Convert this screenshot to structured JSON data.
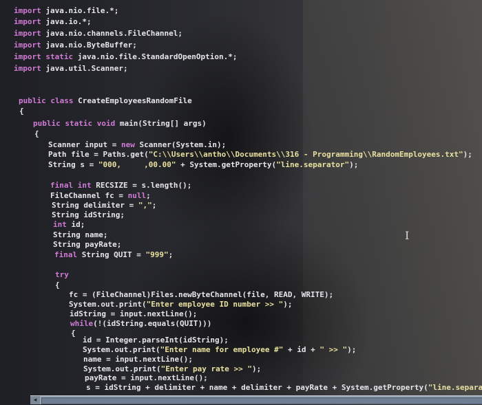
{
  "editor": {
    "lines": [
      [
        {
          "t": "import",
          "c": "kw"
        },
        {
          "t": " java.nio.file.*;",
          "c": "plain"
        }
      ],
      [
        {
          "t": "import",
          "c": "kw"
        },
        {
          "t": " java.io.*;",
          "c": "plain"
        }
      ],
      [
        {
          "t": "import",
          "c": "kw"
        },
        {
          "t": " java.nio.channels.FileChannel;",
          "c": "plain"
        }
      ],
      [
        {
          "t": "import",
          "c": "kw"
        },
        {
          "t": " java.nio.ByteBuffer;",
          "c": "plain"
        }
      ],
      [
        {
          "t": "import",
          "c": "kw"
        },
        {
          "t": " ",
          "c": "plain"
        },
        {
          "t": "static",
          "c": "kw"
        },
        {
          "t": " java.nio.file.StandardOpenOption.*;",
          "c": "plain"
        }
      ],
      [
        {
          "t": "import",
          "c": "kw"
        },
        {
          "t": " java.util.Scanner;",
          "c": "plain"
        }
      ],
      [
        {
          "t": "public",
          "c": "kw"
        },
        {
          "t": " ",
          "c": "plain"
        },
        {
          "t": "class",
          "c": "kw"
        },
        {
          "t": " CreateEmployeesRandomFile",
          "c": "plain"
        }
      ],
      [
        {
          "t": "{",
          "c": "plain"
        }
      ],
      [
        {
          "t": "public",
          "c": "kw"
        },
        {
          "t": " ",
          "c": "plain"
        },
        {
          "t": "static",
          "c": "kw"
        },
        {
          "t": " ",
          "c": "plain"
        },
        {
          "t": "void",
          "c": "kw"
        },
        {
          "t": " main(String[] args)",
          "c": "plain"
        }
      ],
      [
        {
          "t": "{",
          "c": "plain"
        }
      ],
      [
        {
          "t": "Scanner input = ",
          "c": "plain"
        },
        {
          "t": "new",
          "c": "kw"
        },
        {
          "t": " Scanner(System.in);",
          "c": "plain"
        }
      ],
      [
        {
          "t": "Path file = Paths.get(",
          "c": "plain"
        },
        {
          "t": "\"C:\\\\Users\\\\antho\\\\Documents\\\\316 - Programming\\\\RandomEmployees.txt\"",
          "c": "str"
        },
        {
          "t": ");",
          "c": "plain"
        }
      ],
      [
        {
          "t": "String s = ",
          "c": "plain"
        },
        {
          "t": "\"000,     ,00.00\"",
          "c": "str"
        },
        {
          "t": " + System.getProperty(",
          "c": "plain"
        },
        {
          "t": "\"line.separator\"",
          "c": "str"
        },
        {
          "t": ");",
          "c": "plain"
        }
      ],
      [
        {
          "t": "final",
          "c": "kw"
        },
        {
          "t": " ",
          "c": "plain"
        },
        {
          "t": "int",
          "c": "kw"
        },
        {
          "t": " RECSIZE = s.length();",
          "c": "plain"
        }
      ],
      [
        {
          "t": "FileChannel fc = ",
          "c": "plain"
        },
        {
          "t": "null",
          "c": "kw"
        },
        {
          "t": ";",
          "c": "plain"
        }
      ],
      [
        {
          "t": "String delimiter = ",
          "c": "plain"
        },
        {
          "t": "\",\"",
          "c": "str"
        },
        {
          "t": ";",
          "c": "plain"
        }
      ],
      [
        {
          "t": "String idString;",
          "c": "plain"
        }
      ],
      [
        {
          "t": "int",
          "c": "kw"
        },
        {
          "t": " id;",
          "c": "plain"
        }
      ],
      [
        {
          "t": "String name;",
          "c": "plain"
        }
      ],
      [
        {
          "t": "String payRate;",
          "c": "plain"
        }
      ],
      [
        {
          "t": "final",
          "c": "kw"
        },
        {
          "t": " String QUIT = ",
          "c": "plain"
        },
        {
          "t": "\"999\"",
          "c": "str"
        },
        {
          "t": ";",
          "c": "plain"
        }
      ],
      [
        {
          "t": "try",
          "c": "kw"
        }
      ],
      [
        {
          "t": "{",
          "c": "plain"
        }
      ],
      [
        {
          "t": "fc = (FileChannel)Files.newByteChannel(file, READ, WRITE);",
          "c": "plain"
        }
      ],
      [
        {
          "t": "System.out.print(",
          "c": "plain"
        },
        {
          "t": "\"Enter employee ID number >> \"",
          "c": "str"
        },
        {
          "t": ");",
          "c": "plain"
        }
      ],
      [
        {
          "t": "idString = input.nextLine();",
          "c": "plain"
        }
      ],
      [
        {
          "t": "while",
          "c": "kw"
        },
        {
          "t": "(!(idString.equals(QUIT)))",
          "c": "plain"
        }
      ],
      [
        {
          "t": "{",
          "c": "plain"
        }
      ],
      [
        {
          "t": "id = Integer.parseInt(idString);",
          "c": "plain"
        }
      ],
      [
        {
          "t": "System.out.print(",
          "c": "plain"
        },
        {
          "t": "\"Enter name for employee #\"",
          "c": "str"
        },
        {
          "t": " + id + ",
          "c": "plain"
        },
        {
          "t": "\" >> \"",
          "c": "str"
        },
        {
          "t": ");",
          "c": "plain"
        }
      ],
      [
        {
          "t": "name = input.nextLine();",
          "c": "plain"
        }
      ],
      [
        {
          "t": "System.out.print(",
          "c": "plain"
        },
        {
          "t": "\"Enter pay rate >> \"",
          "c": "str"
        },
        {
          "t": ");",
          "c": "plain"
        }
      ],
      [
        {
          "t": "payRate = input.nextLine();",
          "c": "plain"
        }
      ],
      [
        {
          "t": "s = idString + delimiter + name + delimiter + payRate + System.getProperty(",
          "c": "plain"
        },
        {
          "t": "\"line.separator\"",
          "c": "str"
        },
        {
          "t": ");",
          "c": "plain"
        }
      ]
    ]
  },
  "colors": {
    "keyword": "#d07bd6",
    "string": "#e9e0a0",
    "text": "#e6e6ea"
  },
  "scrollbar": {
    "left_arrow": "◂"
  },
  "cursor": {
    "icon": "text-cursor-icon",
    "glyph": "I"
  }
}
